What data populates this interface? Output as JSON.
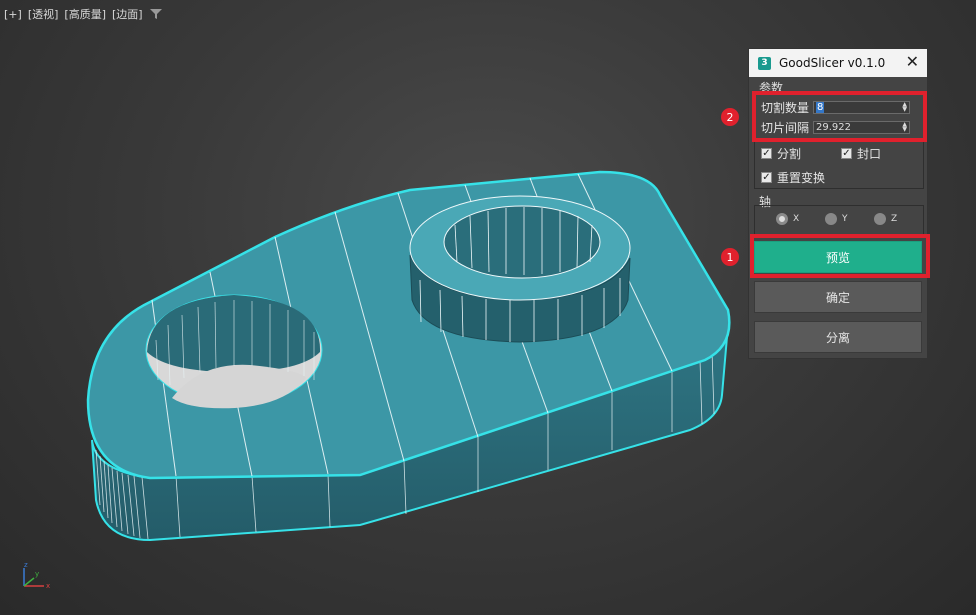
{
  "viewport": {
    "labels": [
      "[+]",
      "[透视]",
      "[高质量]",
      "[边面]"
    ],
    "filter_icon": "filter-icon"
  },
  "axis_gizmo": {
    "x": "x",
    "y": "y",
    "z": "z"
  },
  "dialog": {
    "title": "GoodSlicer v0.1.0",
    "logo_text": "3",
    "close_symbol": "✕",
    "params_group": "参数",
    "slice_count_label": "切割数量",
    "slice_count_value": "8",
    "slice_gap_label": "切片间隔",
    "slice_gap_value": "29.922",
    "split_label": "分割",
    "cap_label": "封口",
    "reset_transform_label": "重置变换",
    "axis_group": "轴",
    "axis_options": [
      "X",
      "Y",
      "Z"
    ],
    "axis_selected": "X",
    "preview_button": "预览",
    "ok_button": "确定",
    "detach_button": "分离"
  },
  "annotations": {
    "badge_1": "1",
    "badge_2": "2"
  },
  "colors": {
    "model_face": "#3c97a6",
    "model_side": "#2e6f7d",
    "outline": "#36e2e8",
    "primary_button": "#1faf8c",
    "highlight": "#e0212d"
  }
}
